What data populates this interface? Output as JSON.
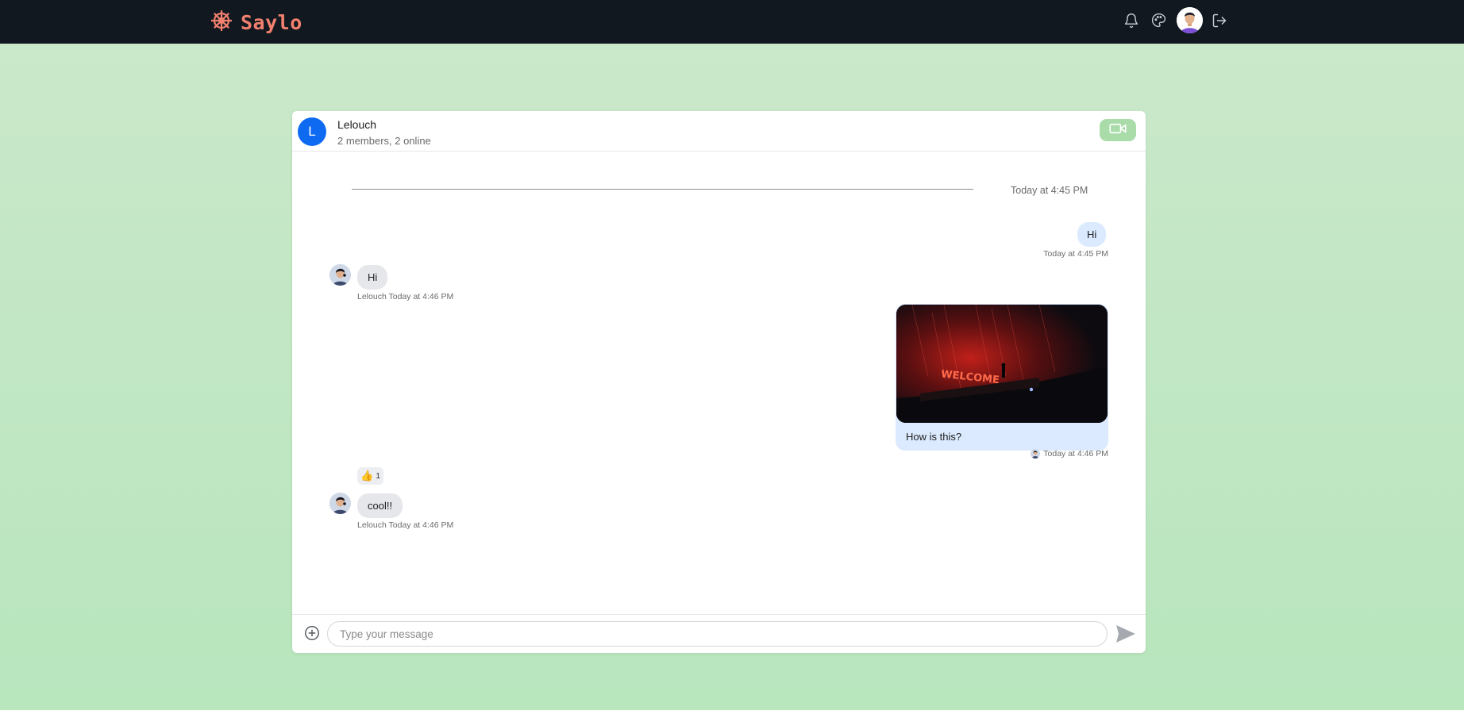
{
  "app": {
    "name": "Saylo"
  },
  "header_icons": {
    "notifications": "bell-icon",
    "theme": "palette-icon",
    "profile": "avatar",
    "logout": "logout-icon"
  },
  "chat": {
    "group_initial": "L",
    "group_name": "Lelouch",
    "group_status": "2 members, 2 online"
  },
  "messages": {
    "date_divider": "Today at 4:45 PM",
    "items": [
      {
        "direction": "out",
        "text": "Hi",
        "meta": "Today at 4:45 PM"
      },
      {
        "direction": "in",
        "text": "Hi",
        "meta": "Lelouch Today at 4:46 PM"
      },
      {
        "direction": "out",
        "image": "neon WELCOME sign in rain",
        "image_text": "WELCOME",
        "text": "How is this?",
        "meta": "Today at 4:46 PM"
      },
      {
        "direction": "in",
        "text": "cool!!",
        "reaction": {
          "emoji": "👍",
          "count": "1"
        },
        "meta": "Lelouch Today at 4:46 PM"
      }
    ]
  },
  "composer": {
    "placeholder": "Type your message"
  },
  "colors": {
    "brand": "#f2806f",
    "topbar": "#111820",
    "accent": "#0f6af2",
    "bubble_out": "#dbeafe",
    "bubble_in": "#e5e7eb",
    "video_button": "#a9dca9"
  }
}
